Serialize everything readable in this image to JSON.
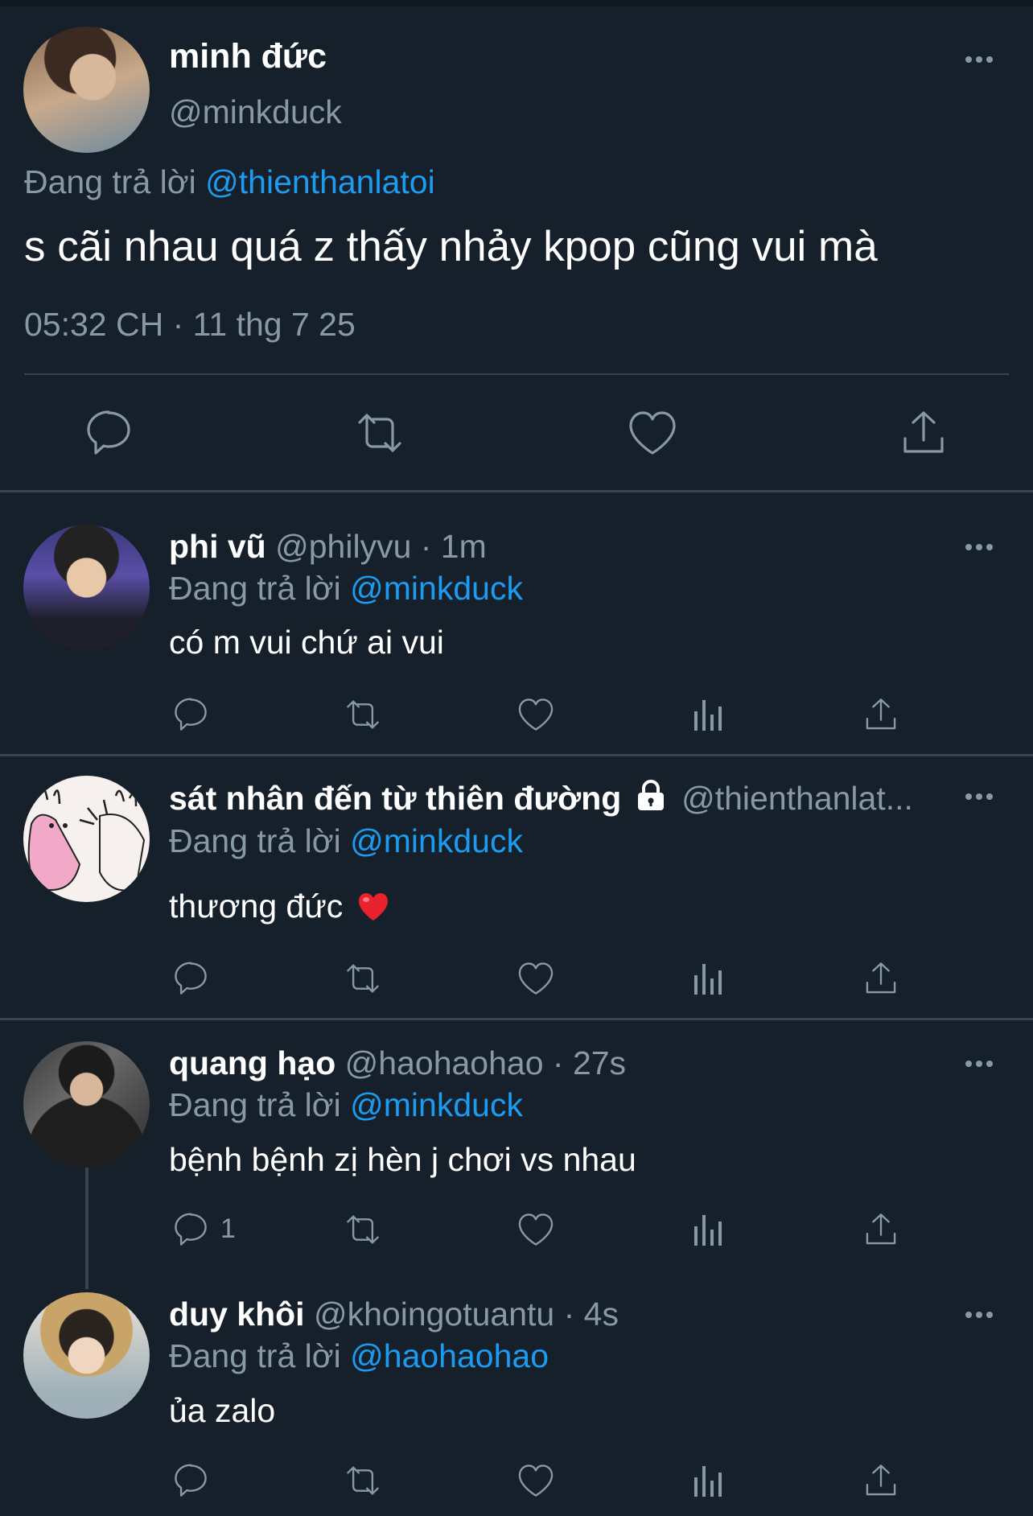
{
  "colors": {
    "background": "#15202b",
    "muted": "#8899a6",
    "link": "#1d9bf0",
    "divider": "#38444d",
    "heart": "#e0245e"
  },
  "main_tweet": {
    "name": "minh đức",
    "handle": "@minkduck",
    "replying_prefix": "Đang trả lời",
    "replying_to": "@thienthanlatoi",
    "text": "s cãi nhau quá z thấy nhảy kpop cũng vui mà",
    "timestamp": "05:32 CH · 11 thg 7 25",
    "actions": [
      "reply-icon",
      "retweet-icon",
      "like-icon",
      "share-icon"
    ]
  },
  "replies": [
    {
      "name": "phi vũ",
      "meta": "@philyvu · 1m",
      "replying_prefix": "Đang trả lời",
      "replying_to": "@minkduck",
      "text": "có m vui chứ ai vui",
      "reply_count": ""
    },
    {
      "name": "sát nhân đến từ thiên đường",
      "meta": "@thienthanlat...",
      "locked": true,
      "replying_prefix": "Đang trả lời",
      "replying_to": "@minkduck",
      "text": "thương đức",
      "emoji": "❤️",
      "reply_count": ""
    },
    {
      "name": "quang hạo",
      "meta": "@haohaohao · 27s",
      "replying_prefix": "Đang trả lời",
      "replying_to": "@minkduck",
      "text": "bệnh bệnh zị hèn j chơi vs nhau",
      "reply_count": "1"
    },
    {
      "name": "duy khôi",
      "meta": "@khoingotuantu · 4s",
      "replying_prefix": "Đang trả lời",
      "replying_to": "@haohaohao",
      "text": "ủa zalo",
      "reply_count": ""
    }
  ]
}
